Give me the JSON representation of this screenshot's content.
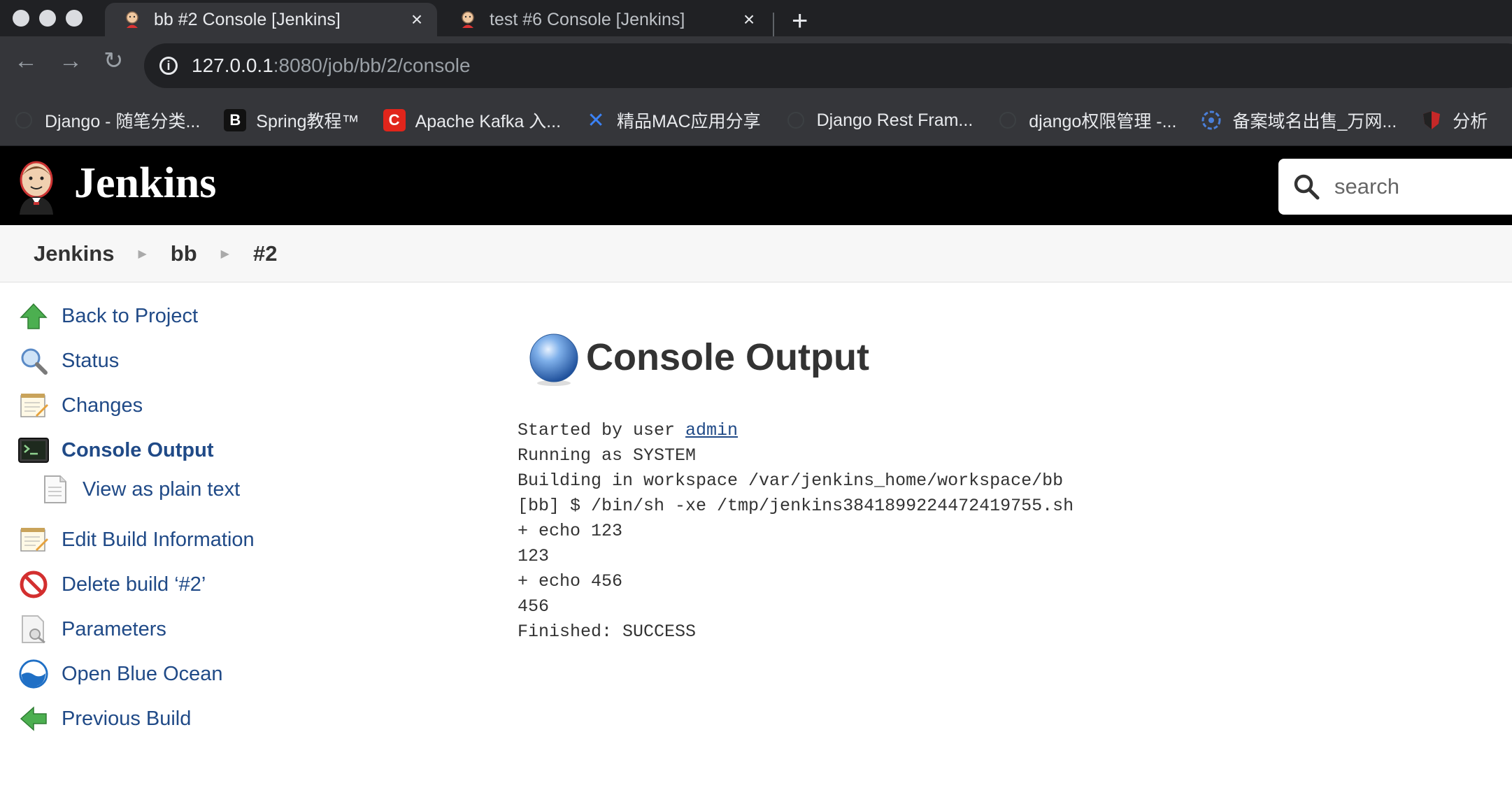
{
  "browser": {
    "tabs": [
      {
        "title": "bb #2 Console [Jenkins]",
        "active": true
      },
      {
        "title": "test #6 Console [Jenkins]",
        "active": false
      }
    ],
    "url_host": "127.0.0.1",
    "url_rest": ":8080/job/bb/2/console",
    "bookmarks": [
      {
        "label": "Django - 随笔分类...",
        "icon": "globe-icon"
      },
      {
        "label": "Spring教程™",
        "icon": "b-icon",
        "glyph": "B"
      },
      {
        "label": "Apache Kafka 入...",
        "icon": "c-icon",
        "glyph": "C"
      },
      {
        "label": "精品MAC应用分享",
        "icon": "x-icon",
        "glyph": "✕"
      },
      {
        "label": "Django Rest Fram...",
        "icon": "globe-icon"
      },
      {
        "label": "django权限管理 -...",
        "icon": "globe-icon"
      },
      {
        "label": "备案域名出售_万网...",
        "icon": "domain-icon"
      },
      {
        "label": "分析",
        "icon": "shield-icon"
      }
    ]
  },
  "header": {
    "title": "Jenkins",
    "search_placeholder": "search"
  },
  "breadcrumbs": [
    "Jenkins",
    "bb",
    "#2"
  ],
  "sidebar": {
    "items": [
      {
        "label": "Back to Project",
        "icon": "up-arrow-icon"
      },
      {
        "label": "Status",
        "icon": "magnifier-icon"
      },
      {
        "label": "Changes",
        "icon": "notepad-icon"
      },
      {
        "label": "Console Output",
        "icon": "terminal-icon",
        "active": true
      },
      {
        "label": "View as plain text",
        "icon": "document-icon"
      },
      {
        "label": "Edit Build Information",
        "icon": "notepad-icon"
      },
      {
        "label": "Delete build ‘#2’",
        "icon": "no-entry-icon"
      },
      {
        "label": "Parameters",
        "icon": "parameters-icon"
      },
      {
        "label": "Open Blue Ocean",
        "icon": "blue-ocean-icon"
      },
      {
        "label": "Previous Build",
        "icon": "left-arrow-icon"
      }
    ]
  },
  "main": {
    "title": "Console Output",
    "status_color": "#4a8fd9",
    "console_prefix": "Started by user ",
    "console_user": "admin",
    "console_lines": [
      "Running as SYSTEM",
      "Building in workspace /var/jenkins_home/workspace/bb",
      "[bb] $ /bin/sh -xe /tmp/jenkins3841899224472419755.sh",
      "+ echo 123",
      "123",
      "+ echo 456",
      "456",
      "Finished: SUCCESS"
    ]
  }
}
